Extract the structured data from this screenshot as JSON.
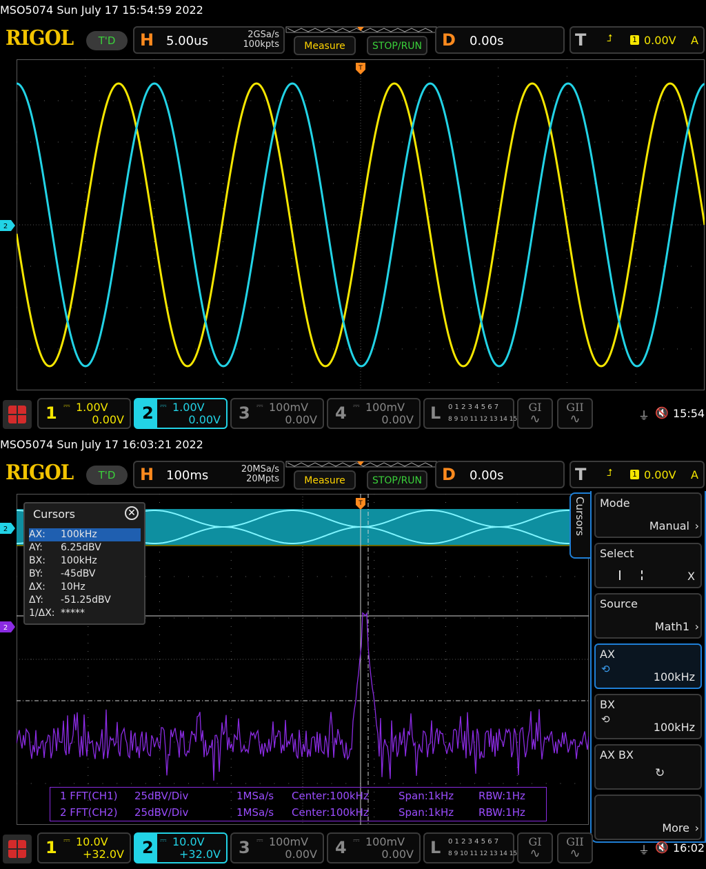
{
  "common": {
    "logo": "RIGOL",
    "td": "T'D",
    "h_letter": "H",
    "d_letter": "D",
    "t_letter": "T",
    "measure": "Measure",
    "stoprun": "STOP/RUN",
    "delay": "0.00s",
    "trig_level": "0.00V",
    "trig_mode": "A",
    "trig_source": "1",
    "ch3_scale": "100mV",
    "ch3_offset": "0.00V",
    "ch4_scale": "100mV",
    "ch4_offset": "0.00V",
    "la_letter": "L",
    "la_row1": "0 1 2 3  4 5 6 7",
    "la_row2": "8 9 10 11 12 13 14 15",
    "g1": "GI",
    "g2": "GII"
  },
  "screen1": {
    "title": "MSO5074  Sun July 17 15:54:59 2022",
    "timebase": "5.00us",
    "rate": "2GSa/s",
    "depth": "100kpts",
    "ch1_scale": "1.00V",
    "ch1_offset": "0.00V",
    "ch2_scale": "1.00V",
    "ch2_offset": "0.00V",
    "clock": "15:54",
    "ch2_marker": "2"
  },
  "screen2": {
    "title": "MSO5074  Sun July 17 16:03:21 2022",
    "timebase": "100ms",
    "rate": "20MSa/s",
    "depth": "20Mpts",
    "ch1_scale": "10.0V",
    "ch1_offset": "+32.0V",
    "ch2_scale": "10.0V",
    "ch2_offset": "+32.0V",
    "clock": "16:02",
    "ch2_marker": "2",
    "math_marker": "2",
    "cursors": {
      "title": "Cursors",
      "rows": [
        {
          "k": "AX:",
          "v": "100kHz"
        },
        {
          "k": "AY:",
          "v": "6.25dBV"
        },
        {
          "k": "BX:",
          "v": "100kHz"
        },
        {
          "k": "BY:",
          "v": "-45dBV"
        },
        {
          "k": "ΔX:",
          "v": "10Hz"
        },
        {
          "k": "ΔY:",
          "v": "-51.25dBV"
        },
        {
          "k": "1/ΔX:",
          "v": "*****"
        }
      ]
    },
    "fft_info": [
      {
        "name": "1 FFT(CH1)",
        "scale": "25dBV/Div",
        "rate": "1MSa/s",
        "center": "Center:100kHz",
        "span": "Span:1kHz",
        "rbw": "RBW:1Hz"
      },
      {
        "name": "2 FFT(CH2)",
        "scale": "25dBV/Div",
        "rate": "1MSa/s",
        "center": "Center:100kHz",
        "span": "Span:1kHz",
        "rbw": "RBW:1Hz"
      }
    ],
    "menu": {
      "tab": "Cursors",
      "mode_title": "Mode",
      "mode_val": "Manual",
      "select_title": "Select",
      "select_val": "X",
      "source_title": "Source",
      "source_val": "Math1",
      "ax_title": "AX",
      "ax_val": "100kHz",
      "bx_title": "BX",
      "bx_val": "100kHz",
      "axbx_title": "AX BX",
      "more": "More"
    }
  },
  "colors": {
    "ch1": "#f5e600",
    "ch2": "#22d3e6",
    "math": "#8a2be2",
    "accent": "#ff8a1e",
    "menu_active": "#1f7fd6"
  }
}
